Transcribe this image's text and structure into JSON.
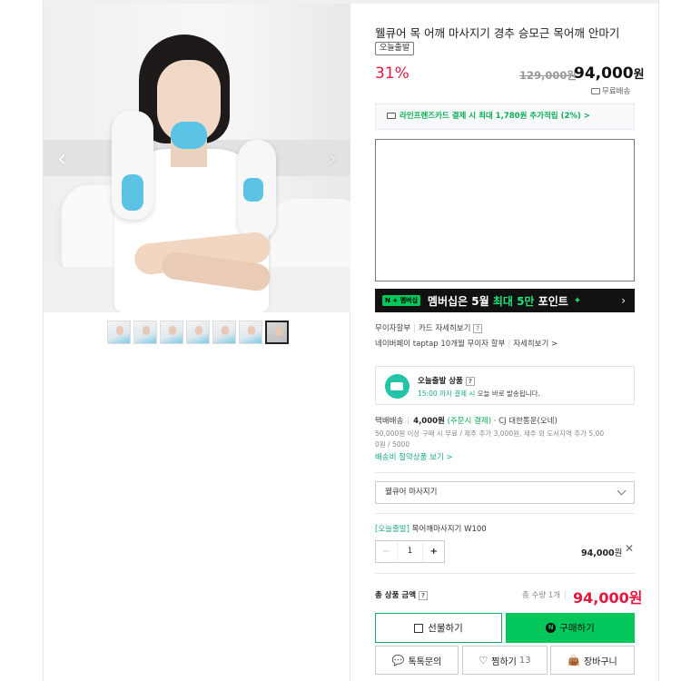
{
  "product": {
    "title": "웰큐어 목 어깨 마사지기 경추 승모근 목어깨 안마기",
    "badge": "오늘출발",
    "discount": "31%",
    "original_price": "129,000원",
    "price": "94,000",
    "price_unit": "원",
    "free_shipping": "무료배송"
  },
  "gallery": {
    "prev": "‹",
    "next": "›",
    "thumbnails": 7,
    "active_thumbnail": 7
  },
  "card_benefit": "라인프렌즈카드 결제 시 최대 1,780원 추가적립 (2%) >",
  "banner": {
    "npay_label": "N + 멤버십",
    "text_prefix": "멤버십은 5월 ",
    "text_highlight": "최대 5만",
    "text_suffix": " 포인트",
    "sparkle": "✦",
    "chevron": "›"
  },
  "installment": {
    "label": "무이자할부",
    "card_detail": "카드 자세히보기",
    "help": "?",
    "npay_line": "네이버페이 taptap 10개월 무이자 할부",
    "detail_link": "자세히보기 >"
  },
  "today_shipping": {
    "title": "오늘출발 상품",
    "help": "?",
    "desc_highlight": "15:00 까지 결제 시",
    "desc_rest": " 오늘 바로 발송됩니다."
  },
  "shipping": {
    "type": "택배배송",
    "fee": "4,000원",
    "fee_note": "(주문시 결제)",
    "carrier": "· CJ 대한통운(오네)",
    "condition_line1": "50,000원 이상 구매 시 무료 / 제주 추가 3,000원, 제주 외 도서지역 추가 5,00",
    "condition_line2": "0원 / 5000",
    "saving_link": "배송비 절약상품 보기 >"
  },
  "option_select": {
    "value": "웰큐어 마사지기"
  },
  "selected_option": {
    "tag": "[오늘출발]",
    "name": " 목어깨마사지기 W100",
    "minus": "−",
    "quantity": "1",
    "plus": "+",
    "price": "94,000",
    "price_unit": "원",
    "remove": "✕"
  },
  "total": {
    "label": "총 상품 금액",
    "help": "?",
    "count": "총 수량 1개",
    "price": "94,000원"
  },
  "buttons": {
    "gift": "선물하기",
    "buy": "구매하기",
    "buy_logo": "N",
    "talk": "톡톡문의",
    "like": "찜하기",
    "like_count": "13",
    "cart": "장바구니"
  },
  "colors": {
    "discount_red": "#e3163e",
    "npay_green": "#03c75a",
    "accent_teal": "#1aab8a"
  }
}
